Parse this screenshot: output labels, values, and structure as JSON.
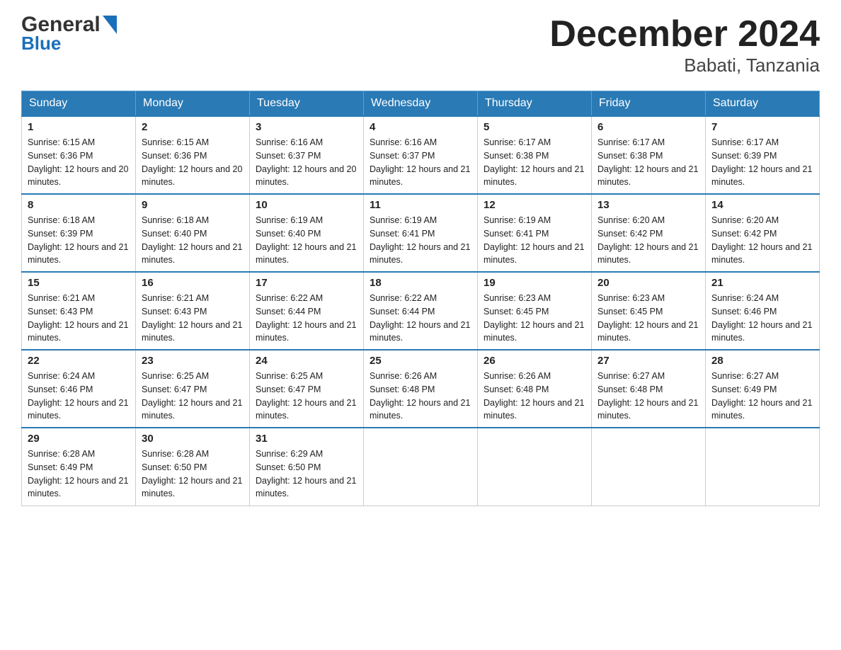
{
  "logo": {
    "general": "General",
    "blue": "Blue",
    "arrow": "▶"
  },
  "title": "December 2024",
  "subtitle": "Babati, Tanzania",
  "days_of_week": [
    "Sunday",
    "Monday",
    "Tuesday",
    "Wednesday",
    "Thursday",
    "Friday",
    "Saturday"
  ],
  "weeks": [
    [
      {
        "num": "1",
        "sunrise": "6:15 AM",
        "sunset": "6:36 PM",
        "daylight": "12 hours and 20 minutes."
      },
      {
        "num": "2",
        "sunrise": "6:15 AM",
        "sunset": "6:36 PM",
        "daylight": "12 hours and 20 minutes."
      },
      {
        "num": "3",
        "sunrise": "6:16 AM",
        "sunset": "6:37 PM",
        "daylight": "12 hours and 20 minutes."
      },
      {
        "num": "4",
        "sunrise": "6:16 AM",
        "sunset": "6:37 PM",
        "daylight": "12 hours and 21 minutes."
      },
      {
        "num": "5",
        "sunrise": "6:17 AM",
        "sunset": "6:38 PM",
        "daylight": "12 hours and 21 minutes."
      },
      {
        "num": "6",
        "sunrise": "6:17 AM",
        "sunset": "6:38 PM",
        "daylight": "12 hours and 21 minutes."
      },
      {
        "num": "7",
        "sunrise": "6:17 AM",
        "sunset": "6:39 PM",
        "daylight": "12 hours and 21 minutes."
      }
    ],
    [
      {
        "num": "8",
        "sunrise": "6:18 AM",
        "sunset": "6:39 PM",
        "daylight": "12 hours and 21 minutes."
      },
      {
        "num": "9",
        "sunrise": "6:18 AM",
        "sunset": "6:40 PM",
        "daylight": "12 hours and 21 minutes."
      },
      {
        "num": "10",
        "sunrise": "6:19 AM",
        "sunset": "6:40 PM",
        "daylight": "12 hours and 21 minutes."
      },
      {
        "num": "11",
        "sunrise": "6:19 AM",
        "sunset": "6:41 PM",
        "daylight": "12 hours and 21 minutes."
      },
      {
        "num": "12",
        "sunrise": "6:19 AM",
        "sunset": "6:41 PM",
        "daylight": "12 hours and 21 minutes."
      },
      {
        "num": "13",
        "sunrise": "6:20 AM",
        "sunset": "6:42 PM",
        "daylight": "12 hours and 21 minutes."
      },
      {
        "num": "14",
        "sunrise": "6:20 AM",
        "sunset": "6:42 PM",
        "daylight": "12 hours and 21 minutes."
      }
    ],
    [
      {
        "num": "15",
        "sunrise": "6:21 AM",
        "sunset": "6:43 PM",
        "daylight": "12 hours and 21 minutes."
      },
      {
        "num": "16",
        "sunrise": "6:21 AM",
        "sunset": "6:43 PM",
        "daylight": "12 hours and 21 minutes."
      },
      {
        "num": "17",
        "sunrise": "6:22 AM",
        "sunset": "6:44 PM",
        "daylight": "12 hours and 21 minutes."
      },
      {
        "num": "18",
        "sunrise": "6:22 AM",
        "sunset": "6:44 PM",
        "daylight": "12 hours and 21 minutes."
      },
      {
        "num": "19",
        "sunrise": "6:23 AM",
        "sunset": "6:45 PM",
        "daylight": "12 hours and 21 minutes."
      },
      {
        "num": "20",
        "sunrise": "6:23 AM",
        "sunset": "6:45 PM",
        "daylight": "12 hours and 21 minutes."
      },
      {
        "num": "21",
        "sunrise": "6:24 AM",
        "sunset": "6:46 PM",
        "daylight": "12 hours and 21 minutes."
      }
    ],
    [
      {
        "num": "22",
        "sunrise": "6:24 AM",
        "sunset": "6:46 PM",
        "daylight": "12 hours and 21 minutes."
      },
      {
        "num": "23",
        "sunrise": "6:25 AM",
        "sunset": "6:47 PM",
        "daylight": "12 hours and 21 minutes."
      },
      {
        "num": "24",
        "sunrise": "6:25 AM",
        "sunset": "6:47 PM",
        "daylight": "12 hours and 21 minutes."
      },
      {
        "num": "25",
        "sunrise": "6:26 AM",
        "sunset": "6:48 PM",
        "daylight": "12 hours and 21 minutes."
      },
      {
        "num": "26",
        "sunrise": "6:26 AM",
        "sunset": "6:48 PM",
        "daylight": "12 hours and 21 minutes."
      },
      {
        "num": "27",
        "sunrise": "6:27 AM",
        "sunset": "6:48 PM",
        "daylight": "12 hours and 21 minutes."
      },
      {
        "num": "28",
        "sunrise": "6:27 AM",
        "sunset": "6:49 PM",
        "daylight": "12 hours and 21 minutes."
      }
    ],
    [
      {
        "num": "29",
        "sunrise": "6:28 AM",
        "sunset": "6:49 PM",
        "daylight": "12 hours and 21 minutes."
      },
      {
        "num": "30",
        "sunrise": "6:28 AM",
        "sunset": "6:50 PM",
        "daylight": "12 hours and 21 minutes."
      },
      {
        "num": "31",
        "sunrise": "6:29 AM",
        "sunset": "6:50 PM",
        "daylight": "12 hours and 21 minutes."
      },
      null,
      null,
      null,
      null
    ]
  ],
  "labels": {
    "sunrise_prefix": "Sunrise: ",
    "sunset_prefix": "Sunset: ",
    "daylight_prefix": "Daylight: "
  }
}
